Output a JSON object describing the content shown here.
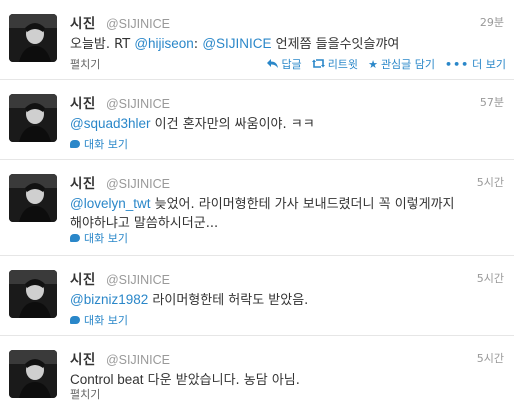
{
  "colors": {
    "link": "#2a87c9",
    "muted": "#999999",
    "divider": "#e6e6e6"
  },
  "tweets": [
    {
      "name": "시진",
      "handle": "@SIJINICE",
      "time": "29분",
      "text": {
        "a": "오늘밤. RT ",
        "mention1": "@hijiseon",
        "b": ": ",
        "mention2": "@SIJINICE",
        "c": " 언제쯤 들을수잇슬꺄여"
      },
      "footer": {
        "expand": "펼치기",
        "reply": "답글",
        "retweet": "리트윗",
        "favorite": "관심글 담기",
        "more": "더 보기",
        "icons": {
          "reply": "reply-arrow-icon",
          "retweet": "retweet-icon",
          "favorite": "star-icon",
          "more": "ellipsis-icon"
        }
      }
    },
    {
      "name": "시진",
      "handle": "@SIJINICE",
      "time": "57분",
      "text": {
        "mention": "@squad3hler",
        "body": " 이건 혼자만의 싸움이야. ㅋㅋ"
      },
      "footer": {
        "conversation": "대화 보기",
        "icon": "speech-bubble-icon"
      }
    },
    {
      "name": "시진",
      "handle": "@SIJINICE",
      "time": "5시간",
      "text": {
        "mention": "@lovelyn_twt",
        "line1": " 늦었어. 라이머형한테 가사 보내드렸더니 꼭 이렇게까지",
        "line2": "해야하냐고 말씀하시더군..."
      },
      "footer": {
        "conversation": "대화 보기",
        "icon": "speech-bubble-icon"
      }
    },
    {
      "name": "시진",
      "handle": "@SIJINICE",
      "time": "5시간",
      "text": {
        "mention": "@bizniz1982",
        "body": " 라이머형한테 허락도 받았음."
      },
      "footer": {
        "conversation": "대화 보기",
        "icon": "speech-bubble-icon"
      }
    },
    {
      "name": "시진",
      "handle": "@SIJINICE",
      "time": "5시간",
      "text": {
        "en": "Control beat",
        "body": " 다운 받았습니다. 농담 아님."
      },
      "footer": {
        "expand": "펼치기"
      }
    }
  ]
}
